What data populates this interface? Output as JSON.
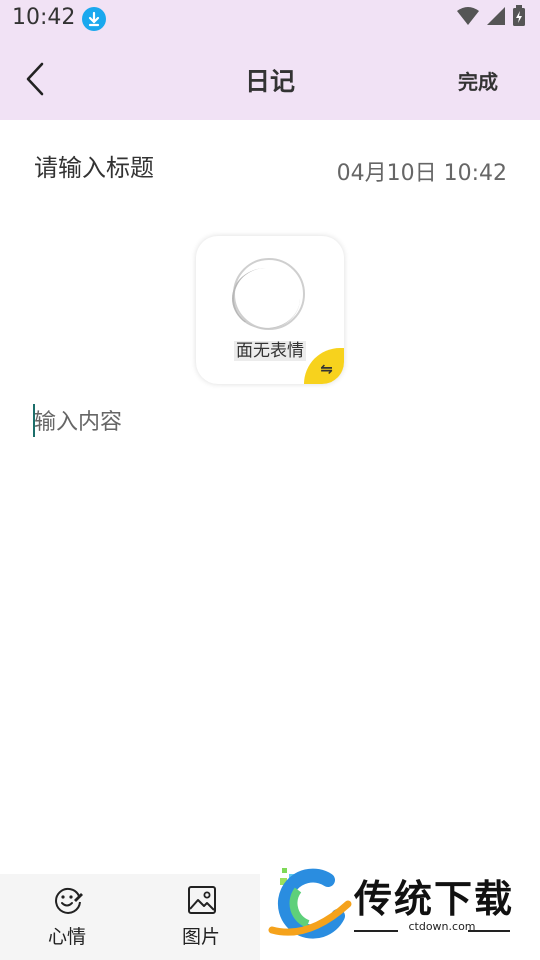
{
  "status_bar": {
    "time": "10:42",
    "icons": [
      "download-icon",
      "wifi-icon",
      "signal-icon",
      "battery-icon"
    ]
  },
  "app_bar": {
    "title": "日记",
    "done_label": "完成"
  },
  "entry": {
    "title_placeholder": "请输入标题",
    "datetime": "04月10日 10:42",
    "content_placeholder": "输入内容"
  },
  "mood": {
    "label": "面无表情",
    "switch_symbol": "⇋"
  },
  "toolbar": {
    "items": [
      {
        "label": "心情",
        "icon": "smiley-pen-icon"
      },
      {
        "label": "图片",
        "icon": "image-icon"
      }
    ]
  },
  "watermark": {
    "brand": "传统下载",
    "url": "ctdown.com"
  },
  "colors": {
    "header_bg": "#f1e2f5",
    "accent_yellow": "#f7d21d",
    "cursor": "#1b6e6a",
    "download_badge": "#1aa8ee"
  }
}
